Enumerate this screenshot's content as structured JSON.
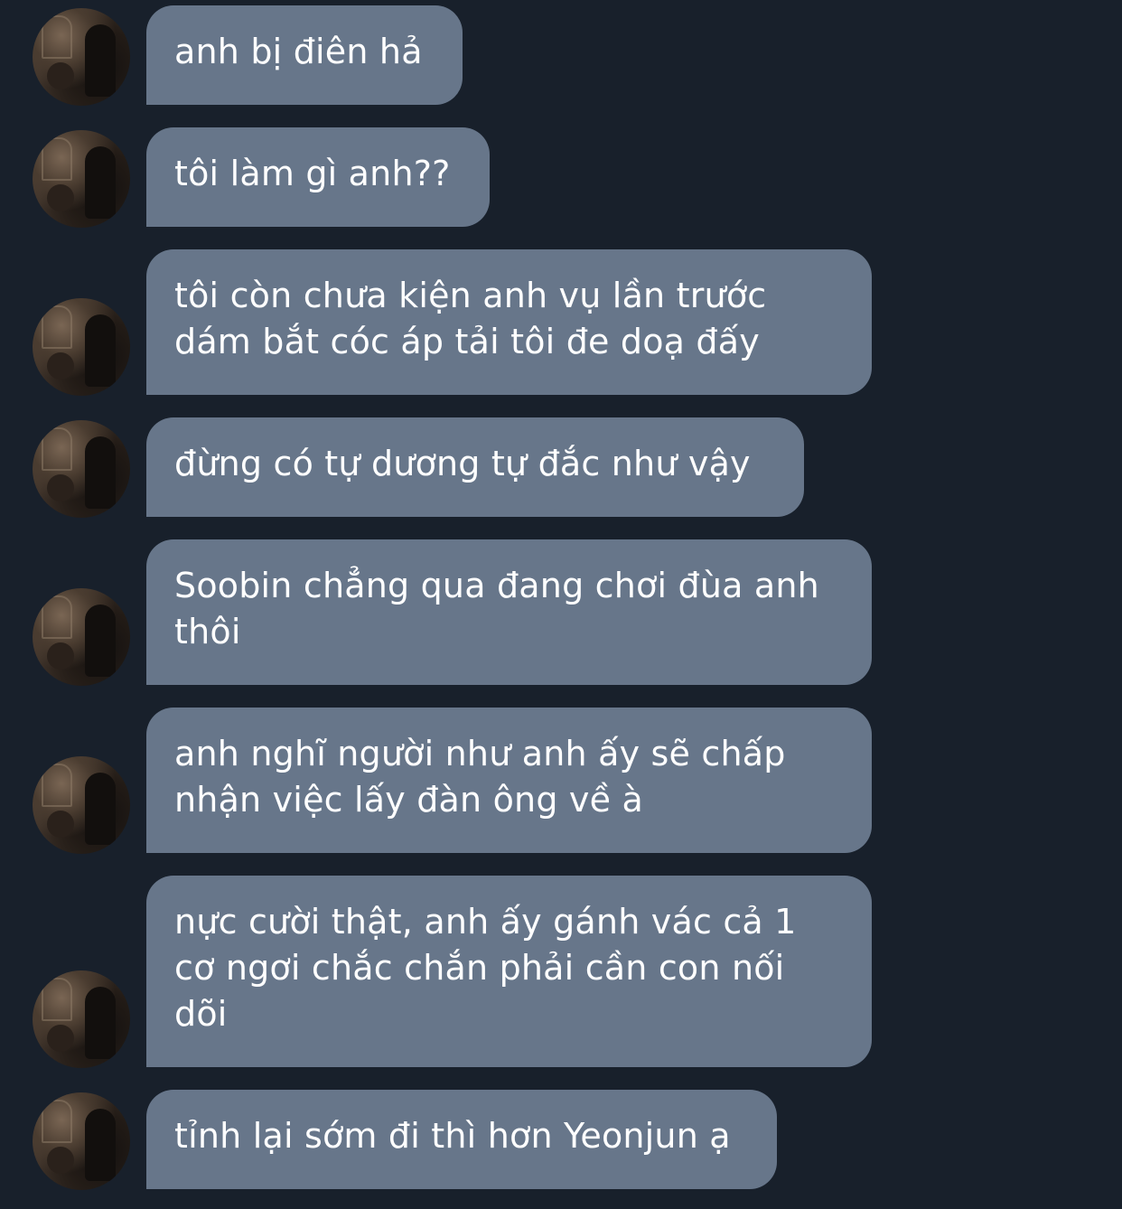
{
  "messages": [
    {
      "text": "anh bị điên hả"
    },
    {
      "text": "tôi làm gì anh??"
    },
    {
      "text": "tôi còn chưa kiện anh vụ lần trước\ndám bắt cóc áp tải tôi đe doạ đấy"
    },
    {
      "text": "đừng có tự dương tự đắc như vậy"
    },
    {
      "text": "Soobin chẳng qua đang chơi đùa anh\nthôi"
    },
    {
      "text": "anh nghĩ người như anh ấy sẽ chấp\nnhận việc lấy đàn ông về à"
    },
    {
      "text": "nực cười thật, anh ấy gánh vác cả 1\ncơ ngơi chắc chắn phải cần con nối\ndõi"
    },
    {
      "text": "tỉnh lại sớm đi thì hơn Yeonjun ạ"
    }
  ],
  "colors": {
    "background": "#18202b",
    "bubble": "#67768a",
    "text": "#ffffff"
  }
}
